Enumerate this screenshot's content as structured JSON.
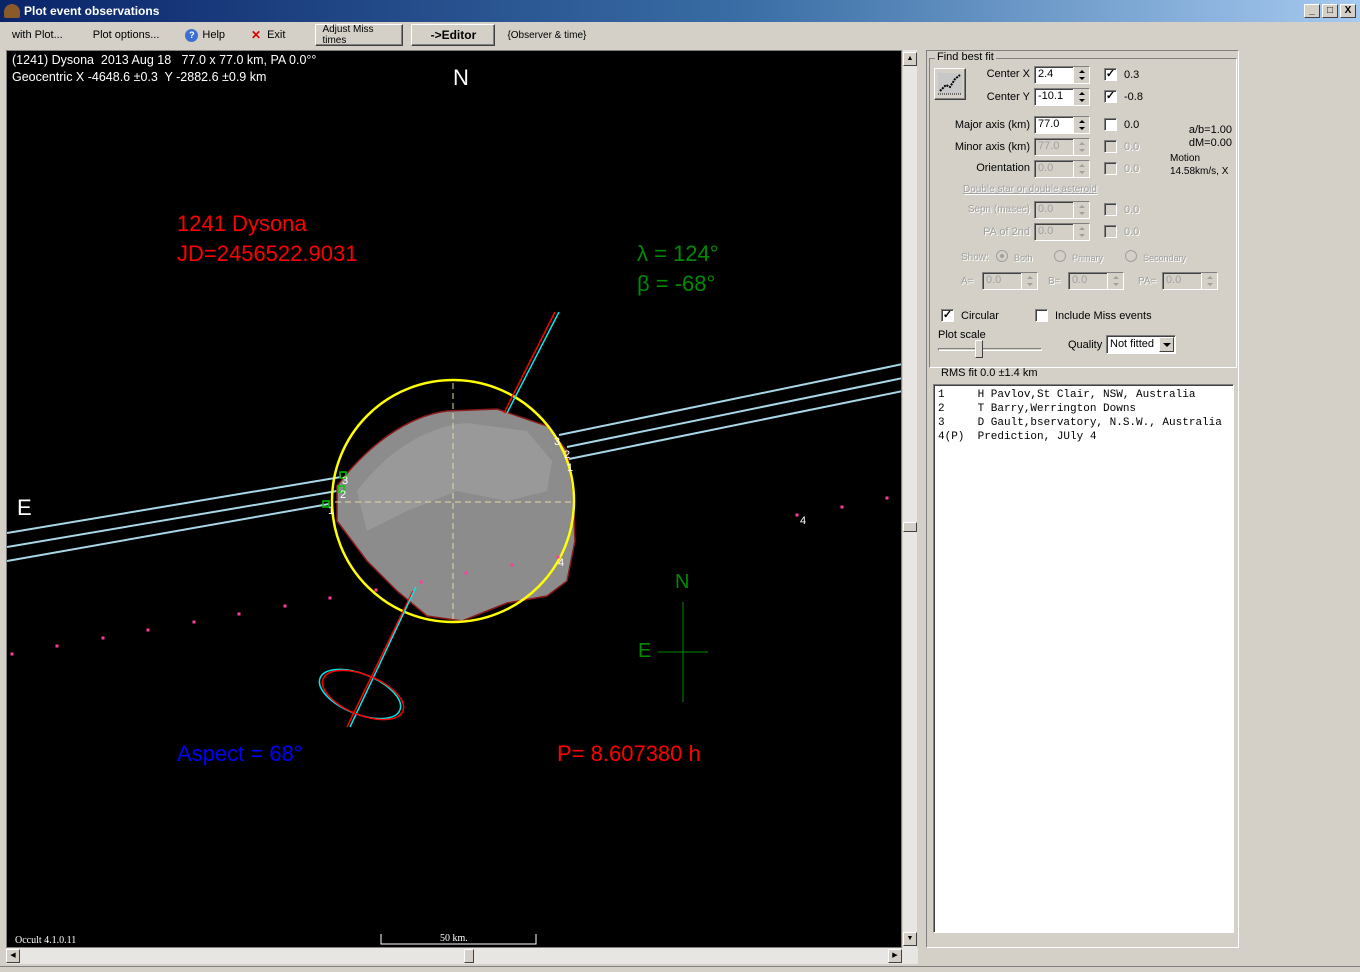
{
  "window": {
    "title": "Plot event observations",
    "minimize": "_",
    "maximize": "□",
    "close": "X"
  },
  "menubar": {
    "with_plot": "with Plot...",
    "plot_options": "Plot options...",
    "help": "Help",
    "exit": "Exit",
    "adjust_miss_times": "Adjust Miss times",
    "editor": "->Editor",
    "observer_time": "{Observer & time}"
  },
  "plot": {
    "header_line1": "(1241) Dysona  2013 Aug 18   77.0 x 77.0 km, PA 0.0°°",
    "header_line2": "Geocentric X -4648.6 ±0.3  Y -2882.6 ±0.9 km",
    "north_label": "N",
    "east_label": "E",
    "asteroid_name": "1241 Dysona",
    "jd": "JD=2456522.9031",
    "lambda": "λ = 124°",
    "beta": "β = -68°",
    "aspect": "Aspect = 68°",
    "period": "P= 8.607380 h",
    "compass_n": "N",
    "compass_e": "E",
    "scale_label": "50 km.",
    "version": "Occult 4.1.0.11",
    "chord_labels_left": [
      "1",
      "2",
      "3"
    ],
    "chord_labels_right": [
      "1",
      "2",
      "3"
    ],
    "prediction_label": "4",
    "colors": {
      "ellipse": "#ffff00",
      "chord": "#a8d8e8",
      "red_text": "#ff0000",
      "green_text": "#008c00",
      "blue_text": "#0000ff",
      "model_shape": "#8c8c8c",
      "prediction_points": "#ff3c9c"
    }
  },
  "panel": {
    "find_best_fit": "Find best fit",
    "center_x": {
      "label": "Center X",
      "value": "2.4",
      "checked": true,
      "delta": "0.3"
    },
    "center_y": {
      "label": "Center Y",
      "value": "-10.1",
      "checked": true,
      "delta": "-0.8"
    },
    "major_axis": {
      "label": "Major axis (km)",
      "value": "77.0",
      "checked": false,
      "delta": "0.0"
    },
    "minor_axis": {
      "label": "Minor axis (km)",
      "value": "77.0",
      "checked": false,
      "delta": "0.0"
    },
    "orientation": {
      "label": "Orientation",
      "value": "0.0",
      "checked": false,
      "delta": "0.0"
    },
    "ab_ratio": "a/b=1.00",
    "dm": "dM=0.00",
    "motion_label": "Motion",
    "motion_value": "14.58km/s, X",
    "double_heading": "Double star  or  double asteroid",
    "sepn": {
      "label": "Sepn (masec)",
      "value": "0.0",
      "delta": "0.0"
    },
    "pa2": {
      "label": "PA of 2nd",
      "value": "0.0",
      "delta": "0.0"
    },
    "show_label": "Show:",
    "show_options": [
      "Both",
      "Primary",
      "Secondary"
    ],
    "show_selected": "Both",
    "a_label": "A=",
    "a_value": "0.0",
    "b_label": "B=",
    "b_value": "0.0",
    "pa_label": "PA=",
    "pa_value": "0.0",
    "circular": {
      "label": "Circular",
      "checked": true
    },
    "include_miss": {
      "label": "Include Miss events",
      "checked": false
    },
    "plot_scale": "Plot scale",
    "quality_label": "Quality",
    "quality_value": "Not fitted",
    "rms_fit": "RMS fit 0.0 ±1.4 km"
  },
  "observers": [
    "1     H Pavlov,St Clair, NSW, Australia",
    "2     T Barry,Werrington Downs",
    "3     D Gault,bservatory, N.S.W., Australia",
    "4(P)  Prediction, JUly 4"
  ]
}
